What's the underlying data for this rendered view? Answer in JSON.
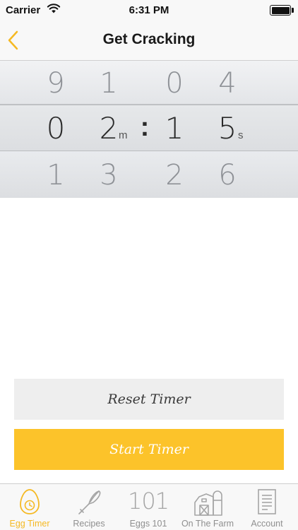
{
  "status_bar": {
    "carrier": "Carrier",
    "time": "6:31 PM",
    "wifi_icon": "wifi-icon",
    "battery_icon": "battery-icon"
  },
  "nav": {
    "title": "Get Cracking",
    "back_icon": "chevron-left-icon"
  },
  "picker": {
    "rows": {
      "above": [
        "9",
        "1",
        "0",
        "4"
      ],
      "selected": [
        "0",
        "2",
        "1",
        "5"
      ],
      "below": [
        "1",
        "3",
        "2",
        "6"
      ]
    },
    "minute_unit": "m",
    "second_unit": "s",
    "separator": ":"
  },
  "buttons": {
    "reset_label": "Reset Timer",
    "start_label": "Start Timer"
  },
  "tabs": [
    {
      "label": "Egg Timer",
      "icon": "egg-timer-icon",
      "active": true
    },
    {
      "label": "Recipes",
      "icon": "whisk-icon",
      "active": false
    },
    {
      "label": "Eggs 101",
      "icon": "number-101-icon",
      "icon_text": "101",
      "active": false
    },
    {
      "label": "On The Farm",
      "icon": "barn-icon",
      "active": false
    },
    {
      "label": "Account",
      "icon": "document-icon",
      "active": false
    }
  ],
  "colors": {
    "accent": "#fcc32a",
    "tab_active": "#f5b923",
    "tab_inactive": "#8f8f8f"
  }
}
